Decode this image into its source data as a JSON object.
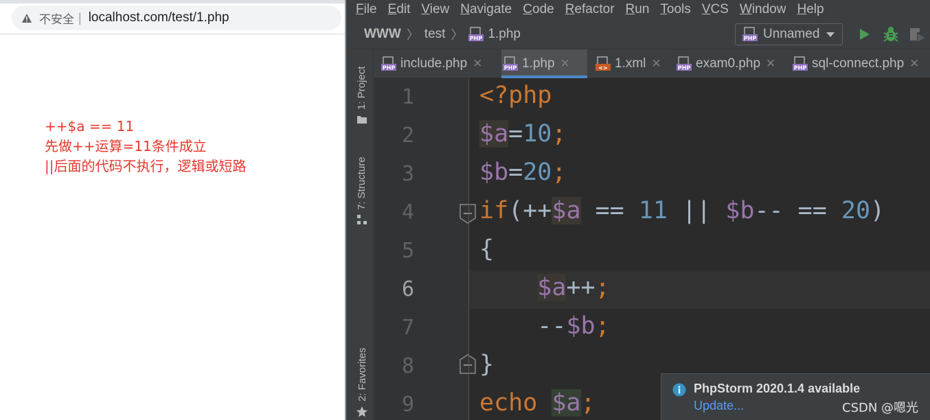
{
  "browser": {
    "security_label": "不安全",
    "url": "localhost.com/test/1.php",
    "output_lines": [
      "++$a == 11",
      "先做++运算=11条件成立",
      "||后面的代码不执行，逻辑或短路"
    ]
  },
  "ide": {
    "menu": [
      "File",
      "Edit",
      "View",
      "Navigate",
      "Code",
      "Refactor",
      "Run",
      "Tools",
      "VCS",
      "Window",
      "Help"
    ],
    "breadcrumb": [
      "WWW",
      "test",
      "1.php"
    ],
    "run_config": "Unnamed",
    "tool_windows": [
      "1: Project",
      "7: Structure",
      "2: Favorites"
    ],
    "tabs": [
      {
        "label": "include.php",
        "active": false
      },
      {
        "label": "1.php",
        "active": true
      },
      {
        "label": "1.xml",
        "active": false
      },
      {
        "label": "exam0.php",
        "active": false
      },
      {
        "label": "sql-connect.php",
        "active": false
      }
    ],
    "line_numbers": [
      "1",
      "2",
      "3",
      "4",
      "5",
      "6",
      "7",
      "8",
      "9"
    ],
    "current_line": "6",
    "code": [
      "<?php",
      "$a=10;",
      "$b=20;",
      "if(++$a == 11 || $b-- == 20)",
      "{",
      "    $a++;",
      "    --$b;",
      "}",
      "echo $a;"
    ],
    "notification": {
      "title": "PhpStorm 2020.1.4 available",
      "link": "Update..."
    },
    "watermark": "CSDN @嗯光"
  },
  "colors": {
    "ide_background": "#3c3f41",
    "editor_background": "#2b2b2b",
    "keyword": "#cc7832",
    "variable": "#9876aa",
    "number": "#6897bb",
    "page_output_text": "#e8382e",
    "active_tab_underline": "#4a88c7"
  }
}
